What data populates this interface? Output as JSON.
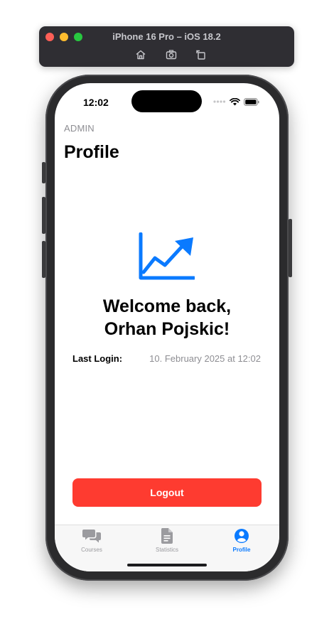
{
  "simulator": {
    "title": "iPhone 16 Pro – iOS 18.2",
    "tools": [
      "home-icon",
      "screenshot-icon",
      "rotate-icon"
    ]
  },
  "status_bar": {
    "time": "12:02"
  },
  "header": {
    "role": "ADMIN",
    "title": "Profile"
  },
  "main": {
    "welcome_line1": "Welcome back,",
    "welcome_line2": "Orhan Pojskic!",
    "last_login_label": "Last Login:",
    "last_login_value": "10. February 2025 at 12:02",
    "logout_label": "Logout"
  },
  "tabs": [
    {
      "label": "Courses",
      "icon": "chat-bubbles-icon",
      "active": false
    },
    {
      "label": "Statistics",
      "icon": "document-icon",
      "active": false
    },
    {
      "label": "Profile",
      "icon": "person-circle-icon",
      "active": true
    }
  ],
  "colors": {
    "accent": "#0a7aff",
    "logout": "#fe3b30",
    "secondary_text": "#8e8e93"
  }
}
